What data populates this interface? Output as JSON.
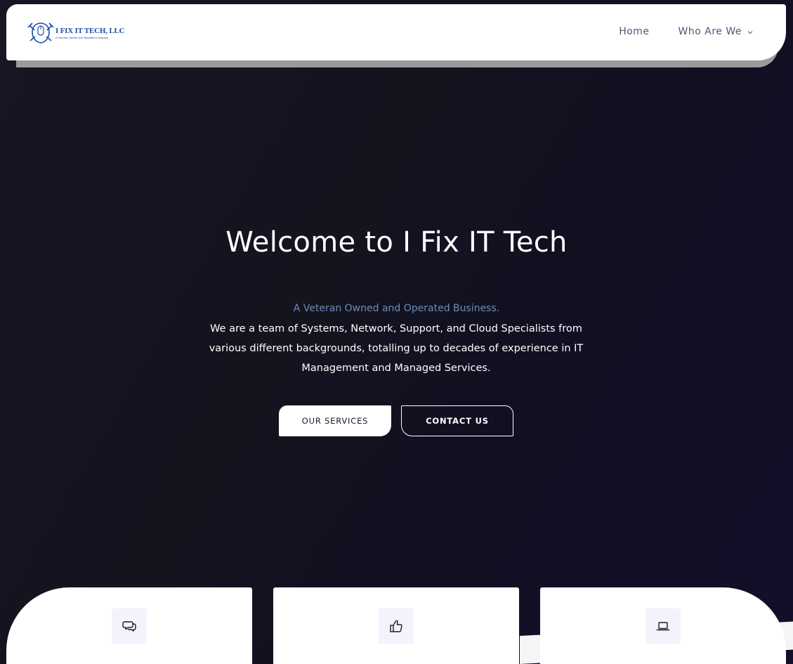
{
  "header": {
    "logo": {
      "name": "I FIX IT TECH, LLC",
      "tagline": "A Veteran Owned and Operated Company"
    },
    "nav": [
      {
        "label": "Home"
      },
      {
        "label": "Who Are We",
        "has_dropdown": true
      }
    ]
  },
  "hero": {
    "title": "Welcome to I Fix IT Tech",
    "tagline": "A Veteran Owned and Operated Business.",
    "description": "We are a team of Systems, Network, Support, and Cloud Specialists from various different backgrounds, totalling up to decades of experience in IT Management and Managed Services.",
    "buttons": {
      "services": "OUR SERVICES",
      "contact": "CONTACT US"
    }
  },
  "features": [
    {
      "icon": "chat-bubbles-icon"
    },
    {
      "icon": "thumbs-up-icon"
    },
    {
      "icon": "laptop-icon"
    }
  ],
  "colors": {
    "background": "#14141f",
    "accent_tagline": "#6d8cb8",
    "nav_text": "#4a5a78",
    "logo_blue": "#1e4aa8",
    "icon_box": "#f4f3fc"
  }
}
